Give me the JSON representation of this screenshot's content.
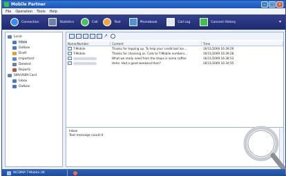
{
  "window": {
    "title": "Mobile Partner"
  },
  "menu": [
    "File",
    "Operation",
    "Tools",
    "Help"
  ],
  "toolbar": [
    {
      "label": "Connection",
      "icon": "globe-icon",
      "color": "#3a8df0"
    },
    {
      "label": "Statistics",
      "icon": "monitor-icon",
      "color": "#6a7fb8"
    },
    {
      "label": "Call",
      "icon": "phone-icon",
      "color": "#52c05a"
    },
    {
      "label": "Text",
      "icon": "envelope-icon",
      "color": "#f2a33a"
    },
    {
      "label": "Phonebook",
      "icon": "book-icon",
      "color": "#4f8fe8"
    },
    {
      "label": "Call Log",
      "icon": "call-log-icon",
      "color": "#e0e6f4"
    },
    {
      "label": "Connect History",
      "icon": "bar-chart-icon",
      "color": "#3fc14a"
    }
  ],
  "tree": [
    {
      "label": "Local",
      "level": 0,
      "icon": "pc-icon",
      "color": "#5b7fc3"
    },
    {
      "label": "Inbox",
      "level": 1,
      "icon": "inbox-icon",
      "color": "#4a78c8",
      "selected": true
    },
    {
      "label": "Outbox",
      "level": 1,
      "icon": "outbox-icon",
      "color": "#4a78c8"
    },
    {
      "label": "Draft",
      "level": 1,
      "icon": "draft-icon",
      "color": "#e0a030"
    },
    {
      "label": "Important",
      "level": 1,
      "icon": "important-icon",
      "color": "#5a88d8"
    },
    {
      "label": "Deleted",
      "level": 1,
      "icon": "trash-icon",
      "color": "#6b7fa8"
    },
    {
      "label": "Reports",
      "level": 1,
      "icon": "report-icon",
      "color": "#c0503a"
    },
    {
      "label": "SIM/USIM Card",
      "level": 0,
      "icon": "sim-icon",
      "color": "#5b7fc3"
    },
    {
      "label": "Inbox",
      "level": 1,
      "icon": "inbox-icon",
      "color": "#4a78c8"
    },
    {
      "label": "Outbox",
      "level": 1,
      "icon": "outbox-icon",
      "color": "#4a78c8"
    }
  ],
  "messages": {
    "columns": [
      "Name/Number",
      "Content",
      "Time"
    ],
    "rows": [
      {
        "name": "T-Mobile",
        "content": "Thanks for topping up. To help your credit last lon...",
        "time": "16/11/2009 16:39:29"
      },
      {
        "name": "T-Mobile",
        "content": "Thanks for choosing us. Calls to T-Mobile numbers...",
        "time": "16/11/2009 16:39:28"
      },
      {
        "name": "",
        "content": "What we really need from the shops is some coffee",
        "time": "16/11/2009 16:38:53"
      },
      {
        "name": "",
        "content": "Hehe. Had a good weekend then?",
        "time": "16/11/2009 16:34:55"
      }
    ]
  },
  "preview": {
    "folder": "Inbox",
    "count_text": "Text message count:4"
  },
  "status": {
    "network": "WCDMA  T-Mobile UK"
  }
}
